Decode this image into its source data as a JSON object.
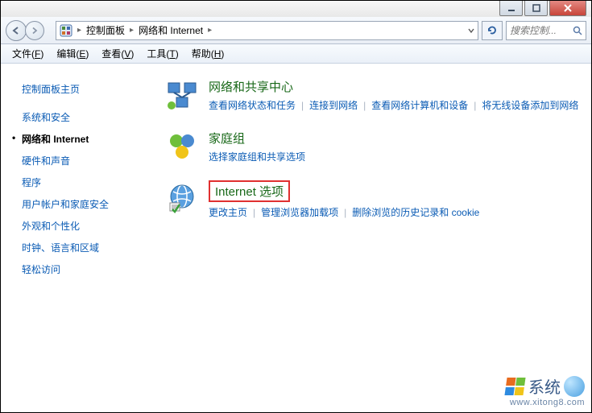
{
  "window": {
    "min_tip": "最小化",
    "max_tip": "最大化",
    "close_tip": "关闭"
  },
  "address": {
    "root_icon_name": "control-panel-icon",
    "crumbs": [
      "控制面板",
      "网络和 Internet"
    ],
    "refresh_tip": "刷新"
  },
  "search": {
    "placeholder": "搜索控制..."
  },
  "menubar": [
    {
      "label": "文件",
      "key": "F"
    },
    {
      "label": "编辑",
      "key": "E"
    },
    {
      "label": "查看",
      "key": "V"
    },
    {
      "label": "工具",
      "key": "T"
    },
    {
      "label": "帮助",
      "key": "H"
    }
  ],
  "sidebar": {
    "items": [
      {
        "label": "控制面板主页",
        "active": false
      },
      {
        "label": "系统和安全",
        "active": false
      },
      {
        "label": "网络和 Internet",
        "active": true
      },
      {
        "label": "硬件和声音",
        "active": false
      },
      {
        "label": "程序",
        "active": false
      },
      {
        "label": "用户帐户和家庭安全",
        "active": false
      },
      {
        "label": "外观和个性化",
        "active": false
      },
      {
        "label": "时钟、语言和区域",
        "active": false
      },
      {
        "label": "轻松访问",
        "active": false
      }
    ]
  },
  "categories": [
    {
      "id": "network-sharing",
      "title": "网络和共享中心",
      "links": [
        "查看网络状态和任务",
        "连接到网络",
        "查看网络计算机和设备",
        "将无线设备添加到网络"
      ],
      "highlighted": false
    },
    {
      "id": "homegroup",
      "title": "家庭组",
      "links": [
        "选择家庭组和共享选项"
      ],
      "highlighted": false
    },
    {
      "id": "internet-options",
      "title": "Internet 选项",
      "links": [
        "更改主页",
        "管理浏览器加载项",
        "删除浏览的历史记录和 cookie"
      ],
      "highlighted": true
    }
  ],
  "watermark": {
    "brand": "系统",
    "url": "www.xitong8.com"
  }
}
